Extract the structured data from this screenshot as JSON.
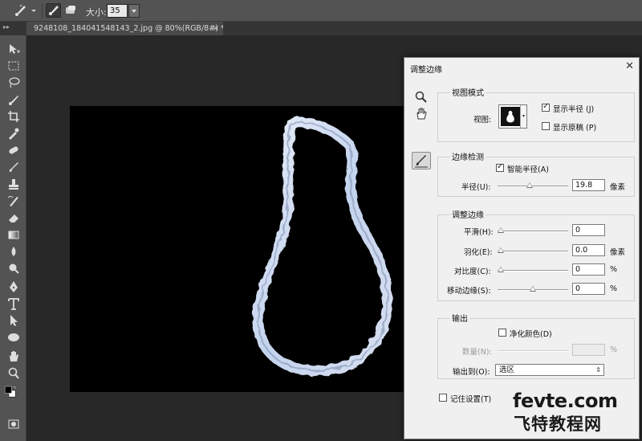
{
  "options_bar": {
    "tool_icon": "quick-selection-brush-icon",
    "size_label": "大小:",
    "size_value": "35"
  },
  "document_tab": {
    "title": "9248108_184041548143_2.jpg @ 80%(RGB/8#) *",
    "close_glyph": "×"
  },
  "toolbar": {
    "tools": [
      "move-icon",
      "marquee-icon",
      "lasso-icon",
      "quick-selection-icon",
      "crop-icon",
      "eyedropper-icon",
      "healing-icon",
      "brush-icon",
      "stamp-icon",
      "history-brush-icon",
      "eraser-icon",
      "gradient-icon",
      "blur-icon",
      "dodge-icon",
      "pen-icon",
      "type-icon",
      "path-selection-icon",
      "shape-icon",
      "hand-icon",
      "zoom-icon"
    ]
  },
  "dialog": {
    "title": "调整边缘",
    "close_glyph": "✕",
    "view_mode": {
      "group_title": "视图模式",
      "view_label": "视图:",
      "show_radius_label": "显示半径 (J)",
      "show_radius_checked": true,
      "show_original_label": "显示原稿 (P)",
      "show_original_checked": false
    },
    "edge_detection": {
      "group_title": "边缘检测",
      "smart_radius_label": "智能半径(A)",
      "smart_radius_checked": true,
      "radius_label": "半径(U):",
      "radius_value": "19.8",
      "radius_unit": "像素",
      "radius_slider_fraction": 0.45
    },
    "adjust_edge": {
      "group_title": "调整边缘",
      "smooth_label": "平滑(H):",
      "smooth_value": "0",
      "smooth_slider_fraction": 0,
      "feather_label": "羽化(E):",
      "feather_value": "0.0",
      "feather_unit": "像素",
      "feather_slider_fraction": 0,
      "contrast_label": "对比度(C):",
      "contrast_value": "0",
      "contrast_unit": "%",
      "contrast_slider_fraction": 0,
      "shift_edge_label": "移动边缘(S):",
      "shift_edge_value": "0",
      "shift_edge_unit": "%",
      "shift_edge_slider_fraction": 0.5
    },
    "output": {
      "group_title": "输出",
      "decontaminate_label": "净化颜色(D)",
      "decontaminate_checked": false,
      "amount_label": "数量(N):",
      "amount_value": "",
      "amount_unit": "%",
      "output_to_label": "输出到(O):",
      "output_to_value": "选区"
    },
    "remember_label": "记住设置(T)",
    "remember_checked": false
  },
  "watermark": {
    "line1": "fevte.com",
    "line2": "飞特教程网"
  }
}
